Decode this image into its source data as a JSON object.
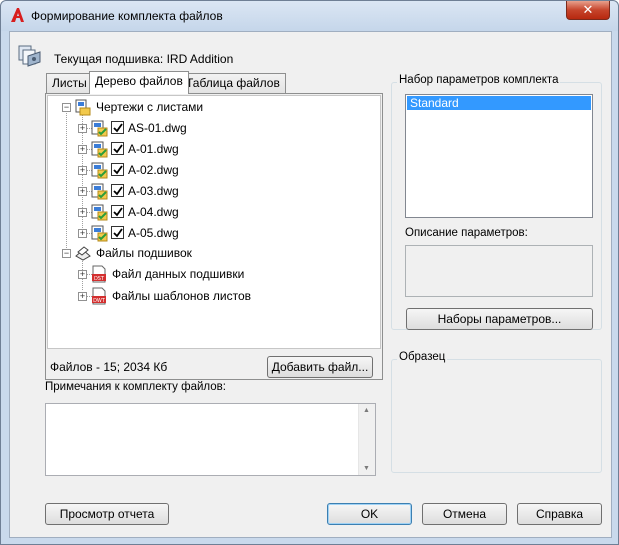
{
  "window": {
    "title": "Формирование комплекта файлов",
    "close_glyph": "✕"
  },
  "current_set": "Текущая подшивка: IRD Addition",
  "tabs": [
    {
      "label": "Листы",
      "active": false
    },
    {
      "label": "Дерево файлов",
      "active": true
    },
    {
      "label": "Таблица файлов",
      "active": false
    }
  ],
  "tree": {
    "drawings_root": "Чертежи с листами",
    "drawings": [
      "AS-01.dwg",
      "A-01.dwg",
      "A-02.dwg",
      "A-03.dwg",
      "A-04.dwg",
      "A-05.dwg"
    ],
    "sheetset_root": "Файлы подшивок",
    "sheetset_items": [
      "Файл данных подшивки",
      "Файлы шаблонов листов"
    ],
    "sheetset_icon_text": [
      "DST",
      "DWT"
    ]
  },
  "files_summary": "Файлов - 15; 2034 Кб",
  "add_file_button": "Добавить файл...",
  "notes_label": "Примечания к комплекту файлов:",
  "notes_value": "",
  "params_group_title": "Набор параметров комплекта",
  "params_list": [
    "Standard"
  ],
  "params_description_label": "Описание параметров:",
  "params_button": "Наборы параметров...",
  "preview_group_title": "Образец",
  "footer": {
    "view_report": "Просмотр отчета",
    "ok": "OK",
    "cancel": "Отмена",
    "help": "Справка"
  },
  "colors": {
    "selection": "#3399ff",
    "close_button": "#c6452c"
  }
}
